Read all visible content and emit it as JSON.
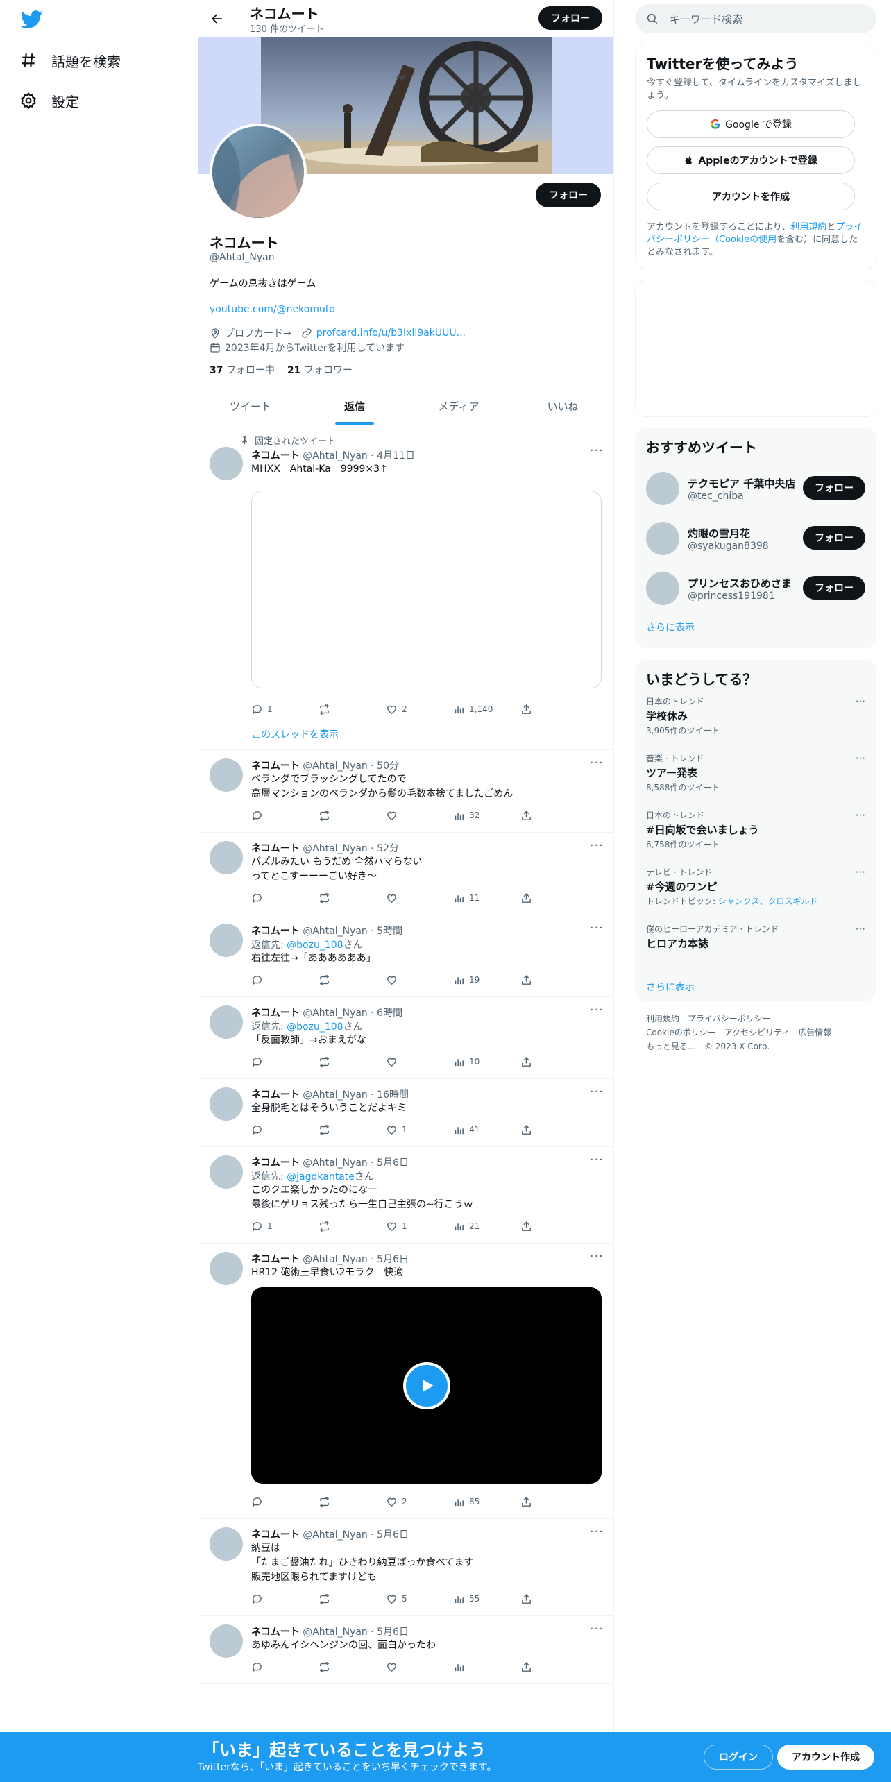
{
  "nav": {
    "items": [
      {
        "label": "話題を検索",
        "icon": "hashtag-icon"
      },
      {
        "label": "設定",
        "icon": "gear-icon"
      }
    ]
  },
  "header": {
    "name": "ネコムート",
    "tweet_count": "130 件のツイート",
    "follow_label": "フォロー"
  },
  "profile": {
    "name": "ネコムート",
    "handle": "@Ahtal_Nyan",
    "bio": "ゲームの息抜きはゲーム",
    "url": "youtube.com/@nekomuto",
    "location": "プロフカード→",
    "link": "profcard.info/u/b3Ixll9akUUU...",
    "joined": "2023年4月からTwitterを利用しています",
    "following_count": "37",
    "following_label": "フォロー中",
    "followers_count": "21",
    "followers_label": "フォロワー",
    "follow_label": "フォロー"
  },
  "tabs": [
    "ツイート",
    "返信",
    "メディア",
    "いいね"
  ],
  "active_tab": 1,
  "tweets": [
    {
      "pinned_label": "固定されたツイート",
      "name": "ネコムート",
      "handle": "@Ahtal_Nyan · 4月11日",
      "reply_prefix": "",
      "reply_to": "",
      "reply_suffix": "",
      "text": "MHXX　Ahtal-Ka　9999×3↑",
      "media": "empty",
      "replies": "1",
      "retweets": "",
      "likes": "2",
      "views": "1,140",
      "thread": "このスレッドを表示"
    },
    {
      "pinned_label": "",
      "name": "ネコムート",
      "handle": "@Ahtal_Nyan · 50分",
      "reply_prefix": "",
      "reply_to": "",
      "reply_suffix": "",
      "text": "ベランダでブラッシングしてたので\n高層マンションのベランダから髪の毛数本捨てましたごめん",
      "media": "",
      "replies": "",
      "retweets": "",
      "likes": "",
      "views": "32",
      "thread": ""
    },
    {
      "pinned_label": "",
      "name": "ネコムート",
      "handle": "@Ahtal_Nyan · 52分",
      "reply_prefix": "",
      "reply_to": "",
      "reply_suffix": "",
      "text": "パズルみたい もうだめ 全然ハマらない\nってとこすーーーごい好き～",
      "media": "",
      "replies": "",
      "retweets": "",
      "likes": "",
      "views": "11",
      "thread": ""
    },
    {
      "pinned_label": "",
      "name": "ネコムート",
      "handle": "@Ahtal_Nyan · 5時間",
      "reply_prefix": "返信先: ",
      "reply_to": "@bozu_108",
      "reply_suffix": "さん",
      "text": "右往左往→「ああああああ」",
      "media": "",
      "replies": "",
      "retweets": "",
      "likes": "",
      "views": "19",
      "thread": ""
    },
    {
      "pinned_label": "",
      "name": "ネコムート",
      "handle": "@Ahtal_Nyan · 6時間",
      "reply_prefix": "返信先: ",
      "reply_to": "@bozu_108",
      "reply_suffix": "さん",
      "text": "「反面教師」→おまえがな",
      "media": "",
      "replies": "",
      "retweets": "",
      "likes": "",
      "views": "10",
      "thread": ""
    },
    {
      "pinned_label": "",
      "name": "ネコムート",
      "handle": "@Ahtal_Nyan · 16時間",
      "reply_prefix": "",
      "reply_to": "",
      "reply_suffix": "",
      "text": "全身脱毛とはそういうことだよキミ",
      "media": "",
      "replies": "",
      "retweets": "",
      "likes": "1",
      "views": "41",
      "thread": ""
    },
    {
      "pinned_label": "",
      "name": "ネコムート",
      "handle": "@Ahtal_Nyan · 5月6日",
      "reply_prefix": "返信先: ",
      "reply_to": "@jagdkantate",
      "reply_suffix": "さん",
      "text": "このクエ楽しかったのになー\n最後にゲリョス残ったら一生自己主張の~行こうｗ",
      "media": "",
      "replies": "1",
      "retweets": "",
      "likes": "1",
      "views": "21",
      "thread": ""
    },
    {
      "pinned_label": "",
      "name": "ネコムート",
      "handle": "@Ahtal_Nyan · 5月6日",
      "reply_prefix": "",
      "reply_to": "",
      "reply_suffix": "",
      "text": "HR12 砲術王早食い2モラク　快適",
      "media": "video",
      "replies": "",
      "retweets": "",
      "likes": "2",
      "views": "85",
      "thread": ""
    },
    {
      "pinned_label": "",
      "name": "ネコムート",
      "handle": "@Ahtal_Nyan · 5月6日",
      "reply_prefix": "",
      "reply_to": "",
      "reply_suffix": "",
      "text": "納豆は\n「たまご醤油たれ」ひきわり納豆ばっか食べてます\n販売地区限られてますけども",
      "media": "",
      "replies": "",
      "retweets": "",
      "likes": "5",
      "views": "55",
      "thread": ""
    },
    {
      "pinned_label": "",
      "name": "ネコムート",
      "handle": "@Ahtal_Nyan · 5月6日",
      "reply_prefix": "",
      "reply_to": "",
      "reply_suffix": "",
      "text": "あゆみんイシヘンジンの回、面白かったわ",
      "media": "",
      "replies": "",
      "retweets": "",
      "likes": "",
      "views": "",
      "thread": ""
    }
  ],
  "search": {
    "placeholder": "キーワード検索"
  },
  "signup": {
    "title": "Twitterを使ってみよう",
    "subtitle": "今すぐ登録して、タイムラインをカスタマイズしましょう。",
    "google": "Google で登録",
    "apple": "Appleのアカウントで登録",
    "create": "アカウントを作成",
    "terms_a": "アカウントを登録することにより、",
    "terms_link1": "利用規約",
    "terms_b": "と",
    "terms_link2": "プライバシーポリシー（Cookieの使用",
    "terms_c": "を含む）に同意したとみなされます。"
  },
  "recommended": {
    "title": "おすすめツイート",
    "users": [
      {
        "name": "テクモピア 千葉中央店",
        "handle": "@tec_chiba"
      },
      {
        "name": "灼眼の雪月花",
        "handle": "@syakugan8398"
      },
      {
        "name": "プリンセスおひめさま",
        "handle": "@princess191981"
      }
    ],
    "follow_label": "フォロー",
    "more": "さらに表示"
  },
  "trends": {
    "title": "いまどうしてる？",
    "items": [
      {
        "category": "日本のトレンド",
        "name": "学校休み",
        "count": "3,905件のツイート",
        "topic_prefix": "",
        "topic_link": ""
      },
      {
        "category": "音楽 · トレンド",
        "name": "ツアー発表",
        "count": "8,588件のツイート",
        "topic_prefix": "",
        "topic_link": ""
      },
      {
        "category": "日本のトレンド",
        "name": "#日向坂で会いましょう",
        "count": "6,758件のツイート",
        "topic_prefix": "",
        "topic_link": ""
      },
      {
        "category": "テレビ · トレンド",
        "name": "#今週のワンピ",
        "count": "",
        "topic_prefix": "トレンドトピック: ",
        "topic_link": "シャンクス、クロスギルド"
      },
      {
        "category": "僕のヒーローアカデミア · トレンド",
        "name": "ヒロアカ本誌",
        "count": "",
        "topic_prefix": "",
        "topic_link": ""
      }
    ],
    "more": "さらに表示"
  },
  "footer": {
    "line1": "利用規約　プライバシーポリシー",
    "line2": "Cookieのポリシー　アクセシビリティ　広告情報",
    "line3": "もっと見る…　© 2023 X Corp."
  },
  "bottombar": {
    "title": "「いま」起きていることを見つけよう",
    "subtitle": "Twitterなら、「いま」起きていることをいち早くチェックできます。",
    "login": "ログイン",
    "signup": "アカウント作成"
  },
  "colors": {
    "accent": "#1d9bf0",
    "dark": "#0f1419",
    "muted": "#536471"
  }
}
